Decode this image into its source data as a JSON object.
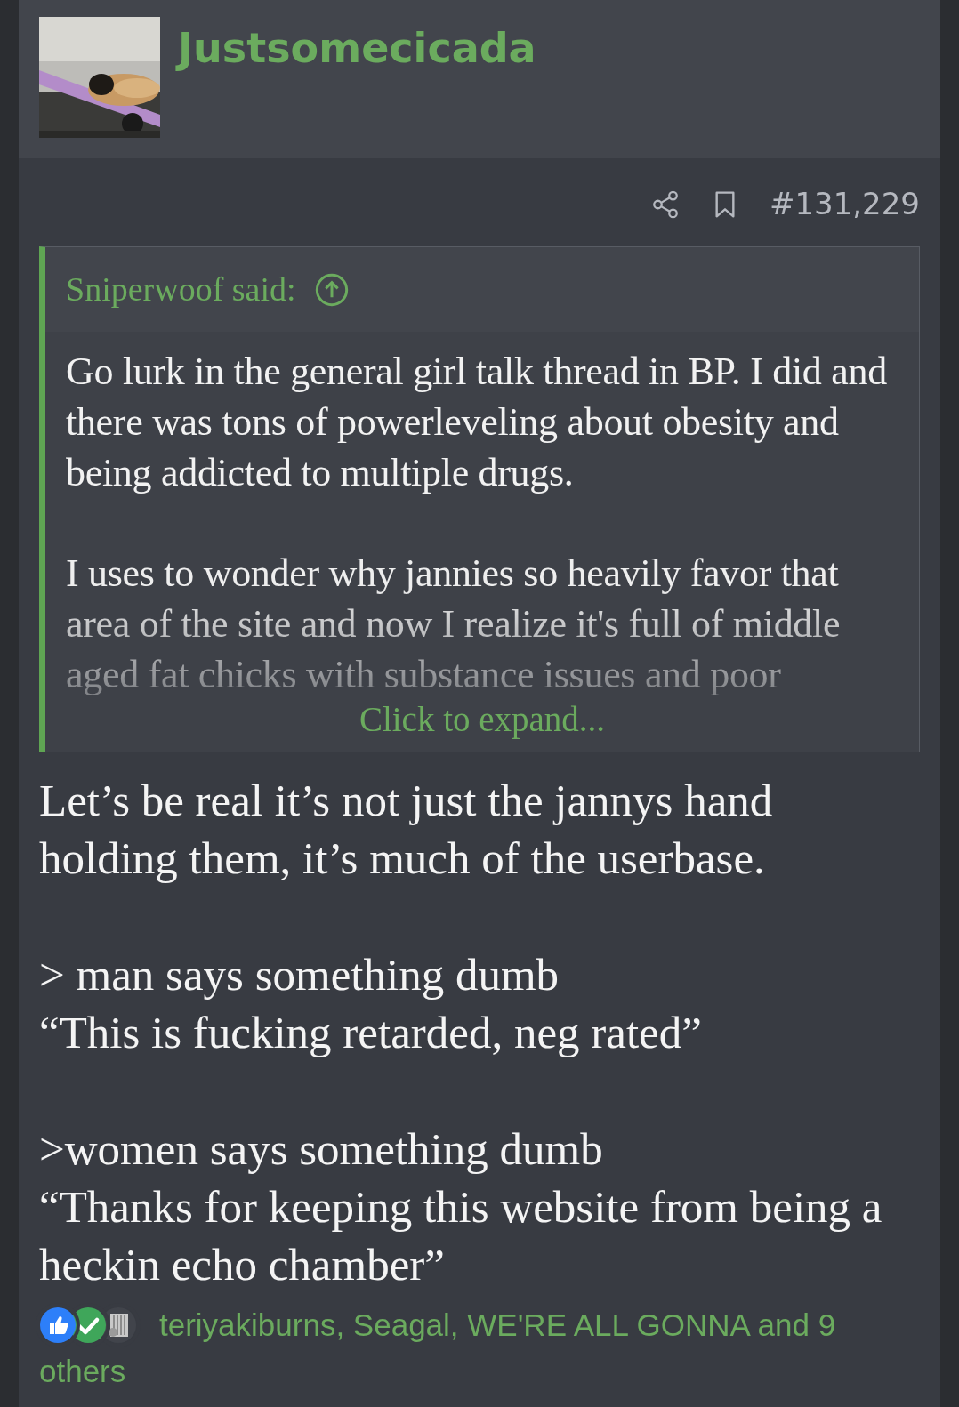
{
  "user": {
    "name": "Justsomecicada"
  },
  "post": {
    "number": "#131,229"
  },
  "quote": {
    "author": "Sniperwoof said:",
    "paragraphs": [
      "Go lurk in the general girl talk thread in BP. I did and there was tons of powerleveling about obesity and being addicted to multiple drugs.",
      "I uses to wonder why jannies so heavily favor that area of the site and now I realize it's full of middle aged fat chicks with substance issues and poor"
    ],
    "expand_label": "Click to expand..."
  },
  "body": {
    "blocks": [
      [
        "Let’s be real it’s not just the jannys hand holding them, it’s much of the userbase."
      ],
      [
        "> man says something dumb",
        "“This is fucking retarded, neg rated”"
      ],
      [
        ">women says something dumb",
        "“Thanks for keeping this website from being a heckin echo chamber”"
      ]
    ]
  },
  "reactions": {
    "icons": [
      {
        "kind": "like"
      },
      {
        "kind": "agree"
      },
      {
        "kind": "grille"
      }
    ],
    "text": "teriyakiburns, Seagal, WE'RE ALL GONNA and 9 others"
  }
}
